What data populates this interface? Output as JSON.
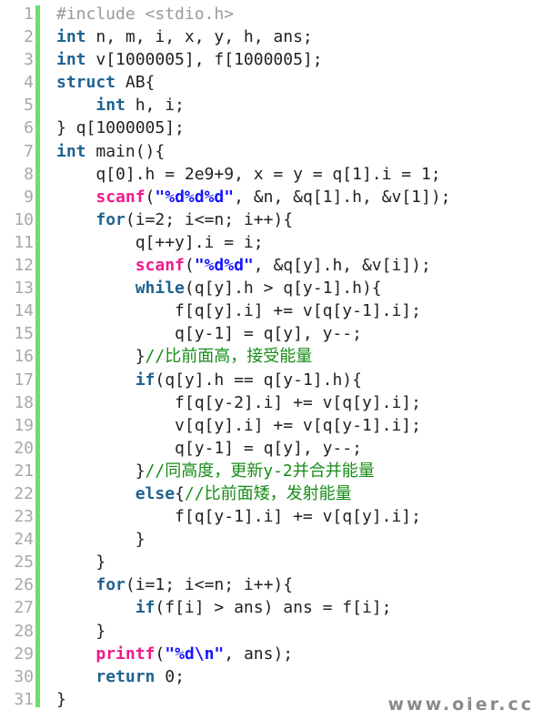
{
  "viewer": {
    "language": "c",
    "total_lines": 31,
    "colors": {
      "background": "#ffffff",
      "gutter_bar": "#6ede6e",
      "line_number": "#a8a8a8",
      "plain": "#222222",
      "keyword": "#1f6391",
      "function": "#f01a8c",
      "string": "#1414ff",
      "comment": "#178c17",
      "preprocessor": "#9a9a9a",
      "watermark": "#8a8a8a"
    }
  },
  "watermark": {
    "text": "www.oier.cc"
  },
  "line_numbers": [
    "1",
    "2",
    "3",
    "4",
    "5",
    "6",
    "7",
    "8",
    "9",
    "10",
    "11",
    "12",
    "13",
    "14",
    "15",
    "16",
    "17",
    "18",
    "19",
    "20",
    "21",
    "22",
    "23",
    "24",
    "25",
    "26",
    "27",
    "28",
    "29",
    "30",
    "31"
  ],
  "code_lines": [
    {
      "number": 1,
      "text": "#include <stdio.h>",
      "tokens": [
        {
          "t": "#include <stdio.h>",
          "k": "preproc"
        }
      ]
    },
    {
      "number": 2,
      "text": "int n, m, i, x, y, h, ans;",
      "tokens": [
        {
          "t": "int",
          "k": "keyword"
        },
        {
          "t": " n, m, i, x, y, h, ans;",
          "k": "plain"
        }
      ]
    },
    {
      "number": 3,
      "text": "int v[1000005], f[1000005];",
      "tokens": [
        {
          "t": "int",
          "k": "keyword"
        },
        {
          "t": " v[1000005], f[1000005];",
          "k": "plain"
        }
      ]
    },
    {
      "number": 4,
      "text": "struct AB{",
      "tokens": [
        {
          "t": "struct",
          "k": "keyword"
        },
        {
          "t": " AB{",
          "k": "plain"
        }
      ]
    },
    {
      "number": 5,
      "text": "    int h, i;",
      "tokens": [
        {
          "t": "    ",
          "k": "plain"
        },
        {
          "t": "int",
          "k": "keyword"
        },
        {
          "t": " h, i;",
          "k": "plain"
        }
      ]
    },
    {
      "number": 6,
      "text": "} q[1000005];",
      "tokens": [
        {
          "t": "} q[1000005];",
          "k": "plain"
        }
      ]
    },
    {
      "number": 7,
      "text": "int main(){",
      "tokens": [
        {
          "t": "int",
          "k": "keyword"
        },
        {
          "t": " main(){",
          "k": "plain"
        }
      ]
    },
    {
      "number": 8,
      "text": "    q[0].h = 2e9+9, x = y = q[1].i = 1;",
      "tokens": [
        {
          "t": "    q[0].h = 2e9+9, x = y = q[1].i = 1;",
          "k": "plain"
        }
      ]
    },
    {
      "number": 9,
      "text": "    scanf(\"%d%d%d\", &n, &q[1].h, &v[1]);",
      "tokens": [
        {
          "t": "    ",
          "k": "plain"
        },
        {
          "t": "scanf",
          "k": "function"
        },
        {
          "t": "(",
          "k": "plain"
        },
        {
          "t": "\"%d%d%d\"",
          "k": "string"
        },
        {
          "t": ", &n, &q[1].h, &v[1]);",
          "k": "plain"
        }
      ]
    },
    {
      "number": 10,
      "text": "    for(i=2; i<=n; i++){",
      "tokens": [
        {
          "t": "    ",
          "k": "plain"
        },
        {
          "t": "for",
          "k": "keyword"
        },
        {
          "t": "(i=2; i<=n; i++){",
          "k": "plain"
        }
      ]
    },
    {
      "number": 11,
      "text": "        q[++y].i = i;",
      "tokens": [
        {
          "t": "        q[++y].i = i;",
          "k": "plain"
        }
      ]
    },
    {
      "number": 12,
      "text": "        scanf(\"%d%d\", &q[y].h, &v[i]);",
      "tokens": [
        {
          "t": "        ",
          "k": "plain"
        },
        {
          "t": "scanf",
          "k": "function"
        },
        {
          "t": "(",
          "k": "plain"
        },
        {
          "t": "\"%d%d\"",
          "k": "string"
        },
        {
          "t": ", &q[y].h, &v[i]);",
          "k": "plain"
        }
      ]
    },
    {
      "number": 13,
      "text": "        while(q[y].h > q[y-1].h){",
      "tokens": [
        {
          "t": "        ",
          "k": "plain"
        },
        {
          "t": "while",
          "k": "keyword"
        },
        {
          "t": "(q[y].h > q[y-1].h){",
          "k": "plain"
        }
      ]
    },
    {
      "number": 14,
      "text": "            f[q[y].i] += v[q[y-1].i];",
      "tokens": [
        {
          "t": "            f[q[y].i] += v[q[y-1].i];",
          "k": "plain"
        }
      ]
    },
    {
      "number": 15,
      "text": "            q[y-1] = q[y], y--;",
      "tokens": [
        {
          "t": "            q[y-1] = q[y], y--;",
          "k": "plain"
        }
      ]
    },
    {
      "number": 16,
      "text": "        }//比前面高，接受能量",
      "tokens": [
        {
          "t": "        }",
          "k": "plain"
        },
        {
          "t": "//比前面高，接受能量",
          "k": "comment"
        }
      ]
    },
    {
      "number": 17,
      "text": "        if(q[y].h == q[y-1].h){",
      "tokens": [
        {
          "t": "        ",
          "k": "plain"
        },
        {
          "t": "if",
          "k": "keyword"
        },
        {
          "t": "(q[y].h == q[y-1].h){",
          "k": "plain"
        }
      ]
    },
    {
      "number": 18,
      "text": "            f[q[y-2].i] += v[q[y].i];",
      "tokens": [
        {
          "t": "            f[q[y-2].i] += v[q[y].i];",
          "k": "plain"
        }
      ]
    },
    {
      "number": 19,
      "text": "            v[q[y].i] += v[q[y-1].i];",
      "tokens": [
        {
          "t": "            v[q[y].i] += v[q[y-1].i];",
          "k": "plain"
        }
      ]
    },
    {
      "number": 20,
      "text": "            q[y-1] = q[y], y--;",
      "tokens": [
        {
          "t": "            q[y-1] = q[y], y--;",
          "k": "plain"
        }
      ]
    },
    {
      "number": 21,
      "text": "        }//同高度，更新y-2并合并能量",
      "tokens": [
        {
          "t": "        }",
          "k": "plain"
        },
        {
          "t": "//同高度，更新y-2并合并能量",
          "k": "comment"
        }
      ]
    },
    {
      "number": 22,
      "text": "        else{//比前面矮，发射能量",
      "tokens": [
        {
          "t": "        ",
          "k": "plain"
        },
        {
          "t": "else",
          "k": "keyword"
        },
        {
          "t": "{",
          "k": "plain"
        },
        {
          "t": "//比前面矮，发射能量",
          "k": "comment"
        }
      ]
    },
    {
      "number": 23,
      "text": "            f[q[y-1].i] += v[q[y].i];",
      "tokens": [
        {
          "t": "            f[q[y-1].i] += v[q[y].i];",
          "k": "plain"
        }
      ]
    },
    {
      "number": 24,
      "text": "        }",
      "tokens": [
        {
          "t": "        }",
          "k": "plain"
        }
      ]
    },
    {
      "number": 25,
      "text": "    }",
      "tokens": [
        {
          "t": "    }",
          "k": "plain"
        }
      ]
    },
    {
      "number": 26,
      "text": "    for(i=1; i<=n; i++){",
      "tokens": [
        {
          "t": "    ",
          "k": "plain"
        },
        {
          "t": "for",
          "k": "keyword"
        },
        {
          "t": "(i=1; i<=n; i++){",
          "k": "plain"
        }
      ]
    },
    {
      "number": 27,
      "text": "        if(f[i] > ans) ans = f[i];",
      "tokens": [
        {
          "t": "        ",
          "k": "plain"
        },
        {
          "t": "if",
          "k": "keyword"
        },
        {
          "t": "(f[i] > ans) ans = f[i];",
          "k": "plain"
        }
      ]
    },
    {
      "number": 28,
      "text": "    }",
      "tokens": [
        {
          "t": "    }",
          "k": "plain"
        }
      ]
    },
    {
      "number": 29,
      "text": "    printf(\"%d\\n\", ans);",
      "tokens": [
        {
          "t": "    ",
          "k": "plain"
        },
        {
          "t": "printf",
          "k": "function"
        },
        {
          "t": "(",
          "k": "plain"
        },
        {
          "t": "\"%d\\n\"",
          "k": "string"
        },
        {
          "t": ", ans);",
          "k": "plain"
        }
      ]
    },
    {
      "number": 30,
      "text": "    return 0;",
      "tokens": [
        {
          "t": "    ",
          "k": "plain"
        },
        {
          "t": "return",
          "k": "keyword"
        },
        {
          "t": " 0;",
          "k": "plain"
        }
      ]
    },
    {
      "number": 31,
      "text": "}",
      "tokens": [
        {
          "t": "}",
          "k": "plain"
        }
      ]
    }
  ]
}
